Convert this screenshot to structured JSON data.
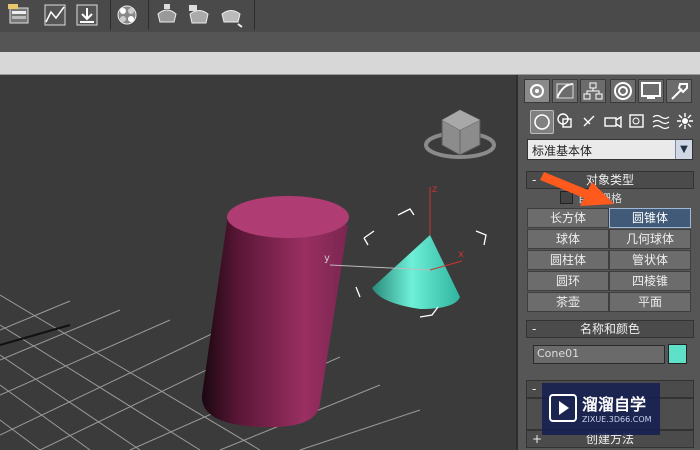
{
  "toolbar": {
    "icons": [
      "layer-manager-icon",
      "curve-editor-icon",
      "schematic-view-icon",
      "material-editor-icon",
      "render-setup-icon",
      "rendered-frame-icon",
      "render-icon"
    ]
  },
  "panel": {
    "tabs": [
      "create-tab",
      "modify-tab",
      "hierarchy-tab",
      "motion-tab",
      "display-tab",
      "utilities-tab"
    ],
    "subtabs": [
      "geometry",
      "shapes",
      "lights",
      "cameras",
      "helpers",
      "space-warps",
      "systems"
    ],
    "dropdown_value": "标准基本体",
    "object_type": {
      "title": "对象类型",
      "autogrid_label": "自动栅格",
      "buttons": [
        "长方体",
        "圆锥体",
        "球体",
        "几何球体",
        "圆柱体",
        "管状体",
        "圆环",
        "四棱锥",
        "茶壶",
        "平面"
      ],
      "active_button": "圆锥体"
    },
    "name_color": {
      "title": "名称和颜色",
      "name_value": "Cone01",
      "color": "#5fe0c8"
    },
    "creation_method": {
      "title": "创建方法"
    }
  },
  "viewport": {
    "axis_labels": {
      "x": "x",
      "y": "y",
      "z": "z"
    }
  },
  "watermark": {
    "title": "溜溜自学",
    "url": "ZIXUE.3D66.COM"
  },
  "colors": {
    "cylinder": "#b03c74",
    "cone": "#4fd8c0",
    "accent_arrow": "#ff5a1e",
    "active_button": "#405a78"
  }
}
